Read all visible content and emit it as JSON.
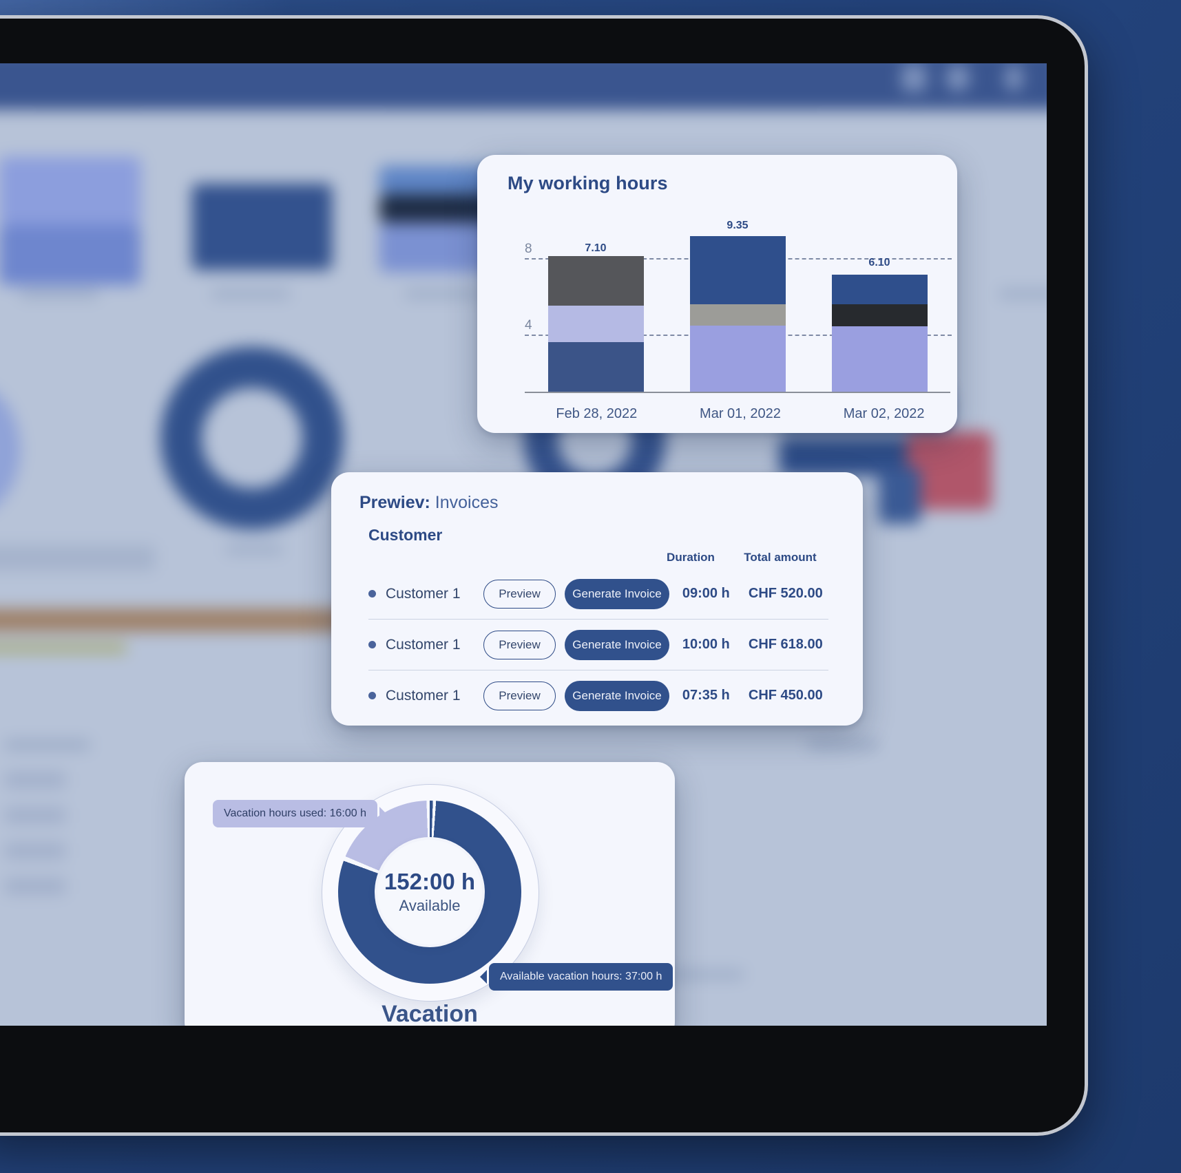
{
  "theme": {
    "brand_dark": "#2d4a85",
    "brand": "#31518c",
    "brand_light": "#9a9fe0",
    "brand_lighter": "#b9bde4",
    "card_bg": "#f4f6fd",
    "page_bg": "#21457e",
    "grey_dark": "#55565a",
    "grey_mid": "#9c9c98",
    "grey_black": "#272a2e"
  },
  "working_hours_card": {
    "title": "My working hours",
    "icons": {
      "bar_chart": "bar-chart-icon"
    }
  },
  "invoices_card": {
    "title_bold": "Prewiev:",
    "title_rest": " Invoices",
    "section_label": "Customer",
    "columns": [
      "",
      "Duration",
      "Total amount"
    ],
    "column_duration": "Duration",
    "column_total": "Total amount",
    "preview_label": "Preview",
    "generate_label": "Generate Invoice",
    "rows": [
      {
        "customer": "Customer 1",
        "preview": "Preview",
        "generate": "Generate Invoice",
        "duration": "09:00 h",
        "amount": "CHF 520.00"
      },
      {
        "customer": "Customer 1",
        "preview": "Preview",
        "generate": "Generate Invoice",
        "duration": "10:00 h",
        "amount": "CHF 618.00"
      },
      {
        "customer": "Customer 1",
        "preview": "Preview",
        "generate": "Generate Invoice",
        "duration": "07:35 h",
        "amount": "CHF 450.00"
      }
    ]
  },
  "vacation_card": {
    "title": "Vacation",
    "center_value": "152:00 h",
    "center_label": "Available",
    "tooltip_used": "Vacation hours used: 16:00 h",
    "tooltip_available": "Available vacation hours: 37:00 h"
  },
  "chart_data": [
    {
      "type": "bar",
      "title": "My working hours",
      "stacked": true,
      "xlabel": "",
      "ylabel": "",
      "ylim": [
        0,
        10
      ],
      "yticks": [
        4,
        8
      ],
      "grid": "dashed-horizontal",
      "categories": [
        "Feb 28, 2022",
        "Mar 01, 2022",
        "Mar 02, 2022"
      ],
      "totals": [
        "7.10",
        "9.35",
        "6.10"
      ],
      "series": [
        {
          "name": "segment-bottom",
          "color": "#3b5488",
          "values": [
            2.6,
            0,
            0
          ]
        },
        {
          "name": "segment-bottom-light",
          "color": "#9a9fe0",
          "values": [
            0,
            4.35,
            3.6
          ]
        },
        {
          "name": "segment-middle-light",
          "color": "#b5bae4",
          "values": [
            1.9,
            0,
            0
          ]
        },
        {
          "name": "segment-middle-grey",
          "color": "#9c9c98",
          "values": [
            0,
            1.0,
            0
          ]
        },
        {
          "name": "segment-middle-black",
          "color": "#272a2e",
          "values": [
            0,
            0,
            0.95
          ]
        },
        {
          "name": "segment-top-darkgrey",
          "color": "#55565a",
          "values": [
            2.6,
            0,
            0
          ]
        },
        {
          "name": "segment-top-blue",
          "color": "#2f4f8c",
          "values": [
            0,
            4.0,
            1.55
          ]
        }
      ]
    },
    {
      "type": "pie",
      "subtype": "donut",
      "title": "Vacation",
      "center_value": "152:00 h",
      "center_label": "Available",
      "labels": [
        "Available vacation hours",
        "Vacation hours used"
      ],
      "values": [
        37,
        16
      ],
      "units": "h",
      "colors": [
        "#31518c",
        "#b9bde4"
      ],
      "annotations": [
        "Vacation hours used: 16:00 h",
        "Available vacation hours: 37:00 h"
      ]
    }
  ],
  "background_dashboard": {
    "blurred": true,
    "note_icons": [
      "doc-icon",
      "user-icon",
      "search-icon"
    ]
  }
}
